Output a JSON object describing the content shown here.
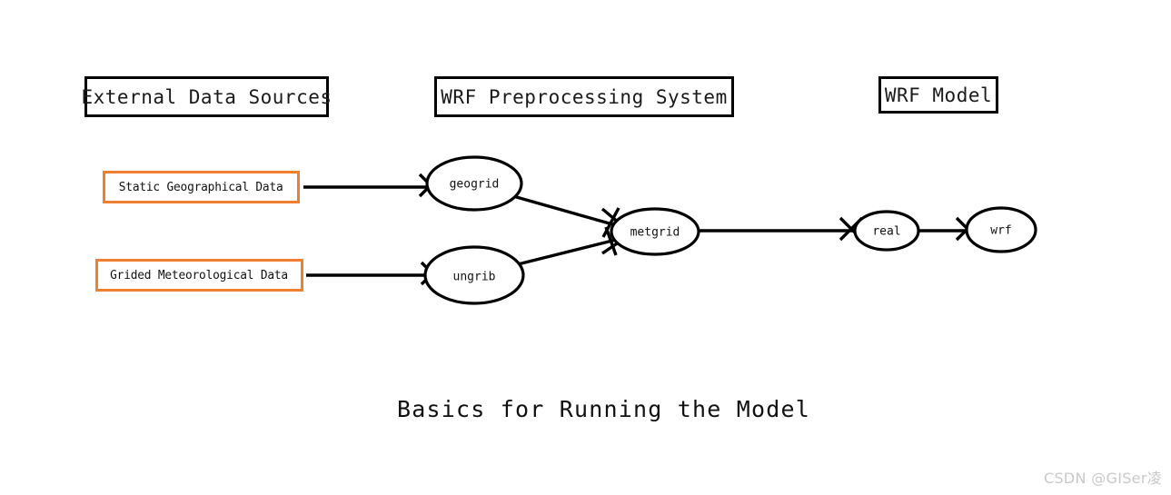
{
  "figure": {
    "caption": "Basics for Running the Model",
    "watermark": "CSDN @GISer凌",
    "background_color": "#ffffff"
  },
  "colors": {
    "group_border": "#000000",
    "data_border": "#f08030",
    "edge": "#000000",
    "text": "#111111",
    "watermark": "#c9c9c9"
  },
  "groups": [
    {
      "id": "external",
      "label": "External Data Sources"
    },
    {
      "id": "wps",
      "label": "WRF Preprocessing System"
    },
    {
      "id": "wrf_model",
      "label": "WRF Model"
    }
  ],
  "data_sources": [
    {
      "id": "static_geo",
      "label": "Static Geographical Data"
    },
    {
      "id": "grided_met",
      "label": "Grided Meteorological Data"
    }
  ],
  "processes": [
    {
      "id": "geogrid",
      "label": "geogrid",
      "group": "wps"
    },
    {
      "id": "ungrib",
      "label": "ungrib",
      "group": "wps"
    },
    {
      "id": "metgrid",
      "label": "metgrid",
      "group": "wps"
    },
    {
      "id": "real",
      "label": "real",
      "group": "wrf_model"
    },
    {
      "id": "wrf",
      "label": "wrf",
      "group": "wrf_model"
    }
  ],
  "edges": [
    {
      "from": "static_geo",
      "to": "geogrid"
    },
    {
      "from": "grided_met",
      "to": "ungrib"
    },
    {
      "from": "geogrid",
      "to": "metgrid"
    },
    {
      "from": "ungrib",
      "to": "metgrid"
    },
    {
      "from": "metgrid",
      "to": "real"
    },
    {
      "from": "real",
      "to": "wrf"
    }
  ]
}
